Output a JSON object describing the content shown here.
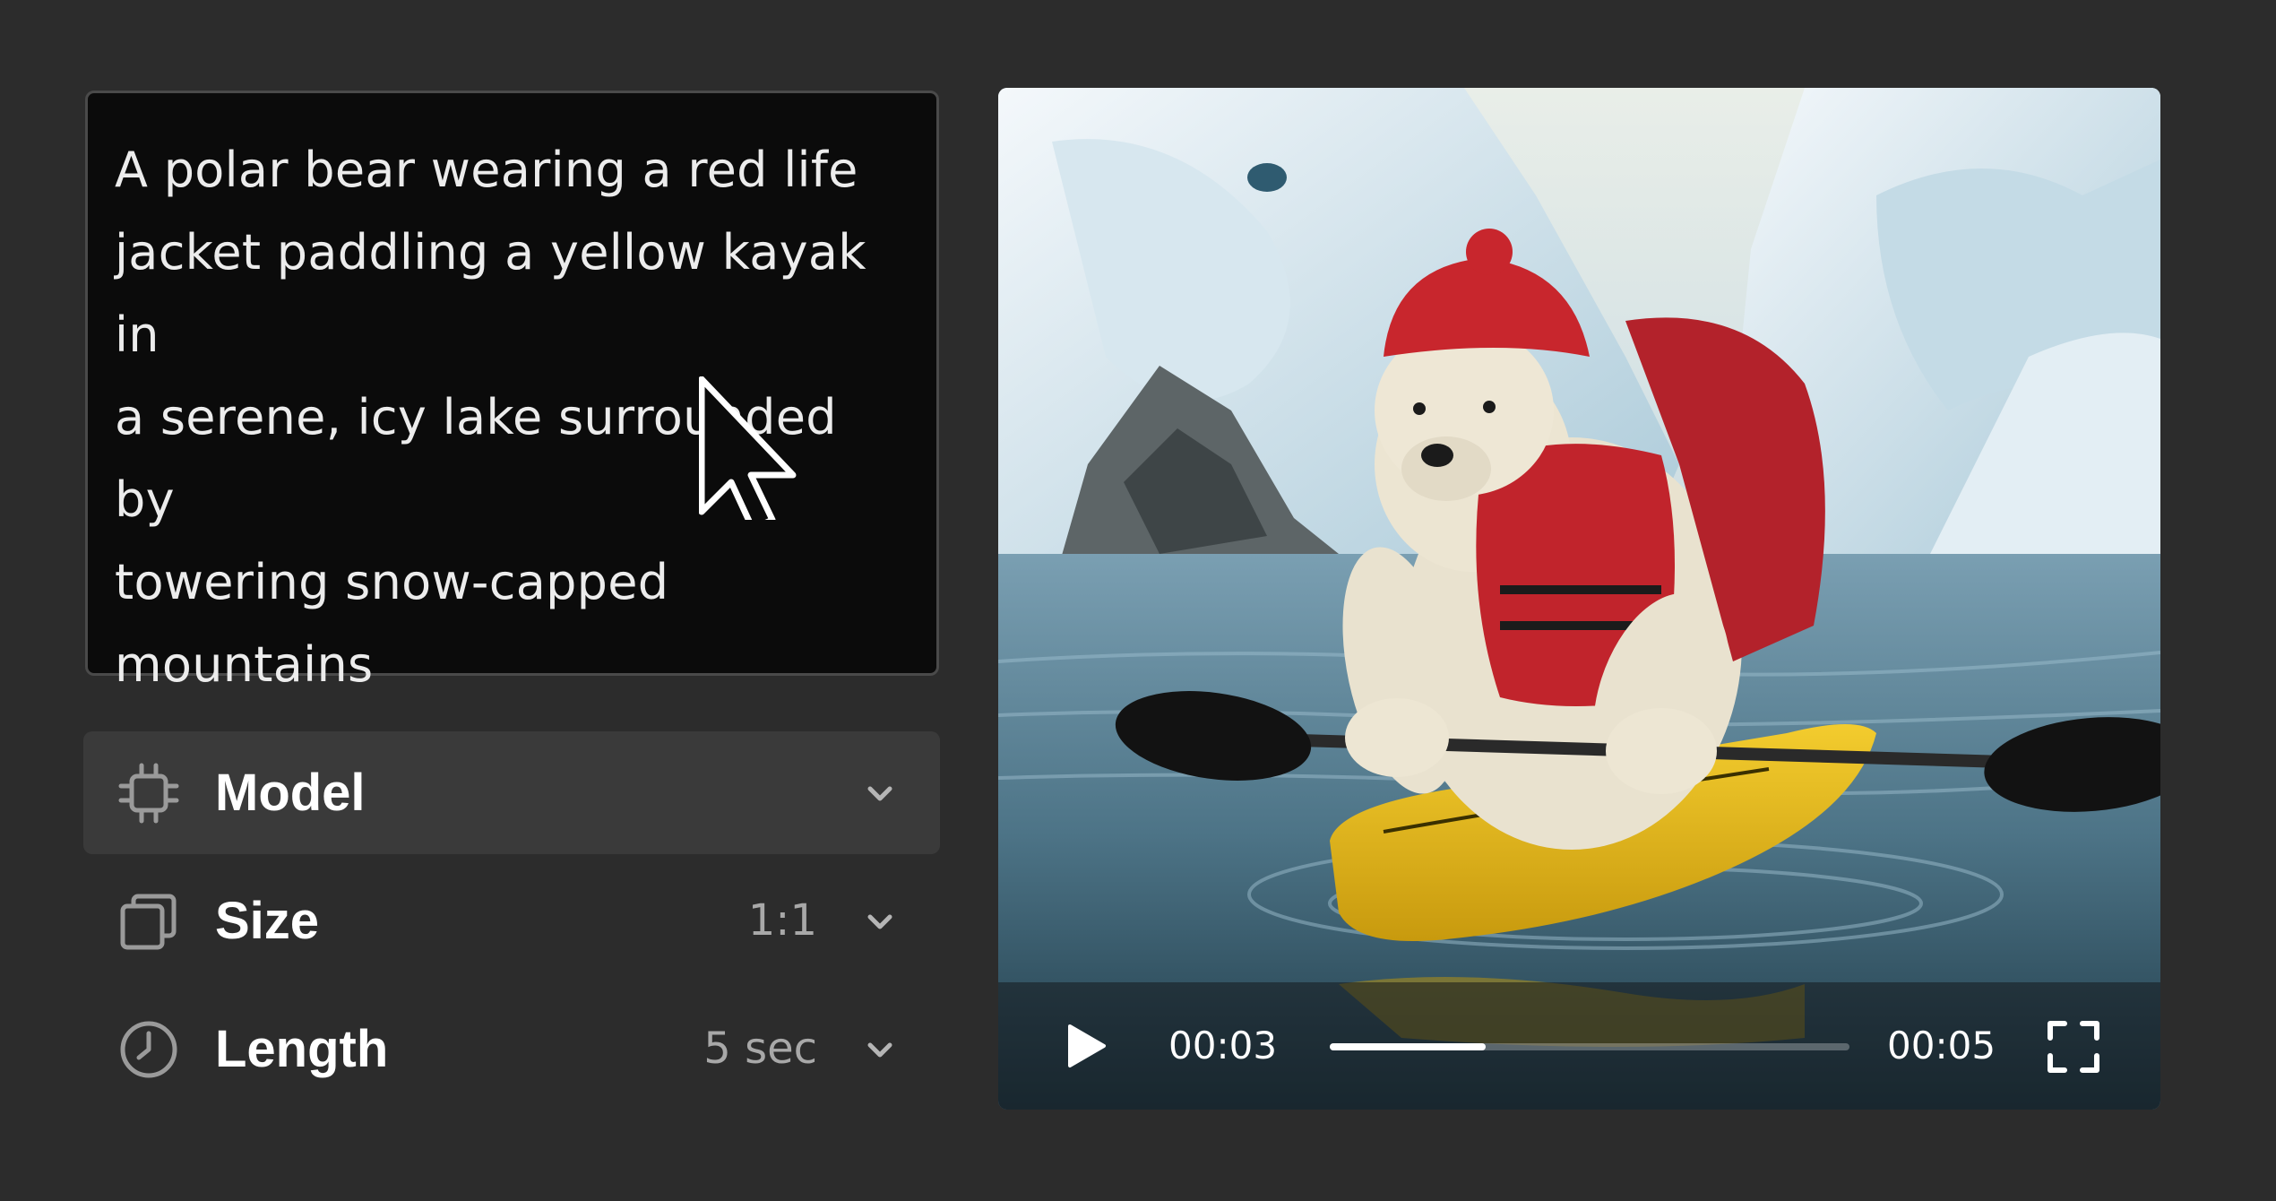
{
  "prompt": {
    "text": "A polar bear wearing a red life jacket paddling a yellow kayak in a serene, icy lake surrounded by towering snow-capped mountains",
    "lines": [
      "A polar bear wearing a red life",
      "jacket paddling a yellow kayak in",
      "a serene, icy lake surrounded by",
      "towering snow-capped",
      "mountains"
    ]
  },
  "settings": [
    {
      "label": "Model",
      "value": "",
      "icon": "chip-icon",
      "active": true
    },
    {
      "label": "Size",
      "value": "1:1",
      "icon": "aspect-ratio-icon",
      "active": false
    },
    {
      "label": "Length",
      "value": "5 sec",
      "icon": "clock-icon",
      "active": false
    }
  ],
  "player": {
    "current_time": "00:03",
    "total_time": "00:05",
    "progress": 0.3
  },
  "colors": {
    "background": "#2c2c2c",
    "prompt_bg": "#0b0b0b",
    "active_row": "#3a3a3a",
    "muted_text": "#a8a8a8"
  }
}
